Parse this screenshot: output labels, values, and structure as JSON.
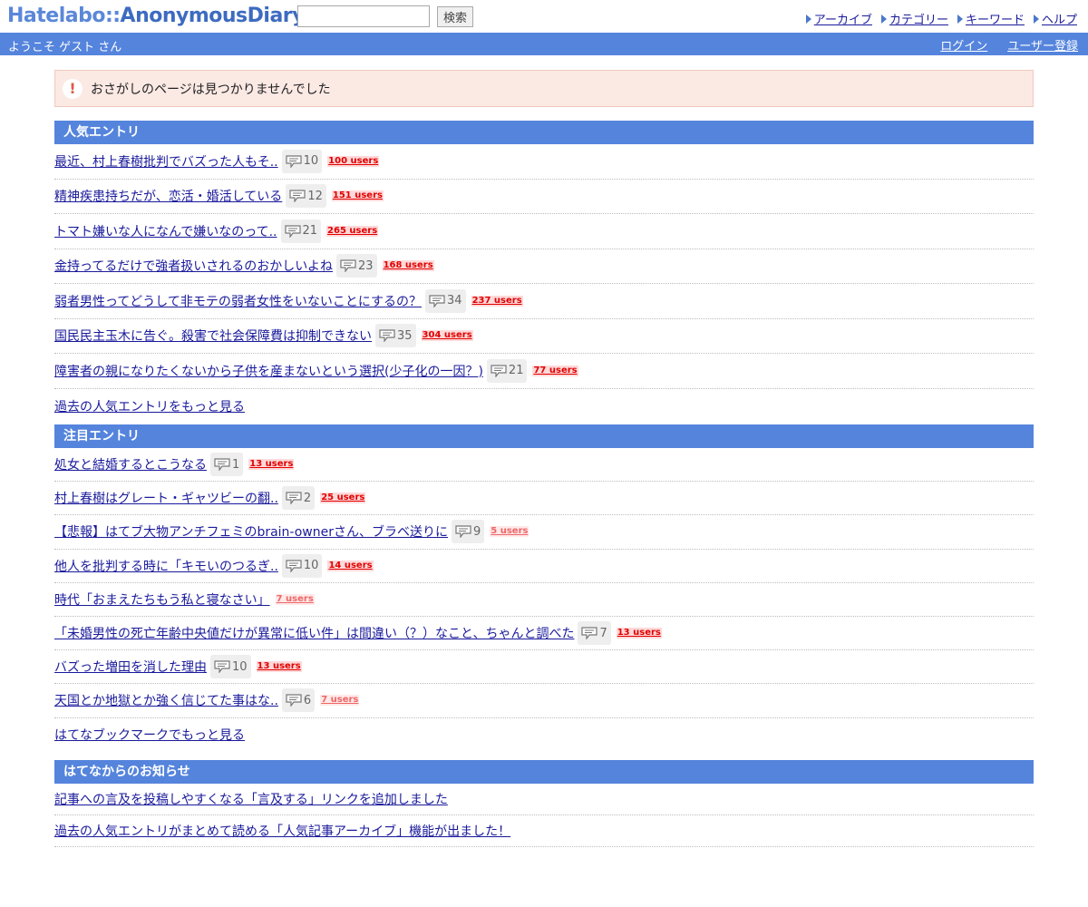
{
  "header": {
    "logo_main": "Hatelabo::",
    "logo_sub": "AnonymousDiary",
    "search_placeholder": "",
    "search_button": "検索",
    "nav": [
      "アーカイブ",
      "カテゴリー",
      "キーワード",
      "ヘルプ"
    ]
  },
  "bar": {
    "welcome": "ようこそ ゲスト さん",
    "login": "ログイン",
    "register": "ユーザー登録"
  },
  "notice": {
    "icon": "!",
    "text": "おさがしのページは見つかりませんでした"
  },
  "popular": {
    "title": "人気エントリ",
    "entries": [
      {
        "title": "最近、村上春樹批判でバズった人もそ..",
        "comments": "10",
        "users": "100 users",
        "style": "hot"
      },
      {
        "title": "精神疾患持ちだが、恋活・婚活している",
        "comments": "12",
        "users": "151 users",
        "style": "hot"
      },
      {
        "title": "トマト嫌いな人になんで嫌いなのって..",
        "comments": "21",
        "users": "265 users",
        "style": "hot"
      },
      {
        "title": "金持ってるだけで強者扱いされるのおかしいよね",
        "comments": "23",
        "users": "168 users",
        "style": "hot"
      },
      {
        "title": "弱者男性ってどうして非モテの弱者女性をいないことにするの？",
        "comments": "34",
        "users": "237 users",
        "style": "hot"
      },
      {
        "title": "国民民主玉木に告ぐ。殺害で社会保障費は抑制できない",
        "comments": "35",
        "users": "304 users",
        "style": "hot"
      },
      {
        "title": "障害者の親になりたくないから子供を産まないという選択(少子化の一因？)",
        "comments": "21",
        "users": "77 users",
        "style": "hot"
      }
    ],
    "more": "過去の人気エントリをもっと見る"
  },
  "featured": {
    "title": "注目エントリ",
    "entries": [
      {
        "title": "処女と結婚するとこうなる",
        "comments": "1",
        "users": "13 users",
        "style": "hot"
      },
      {
        "title": "村上春樹はグレート・ギャツビーの翻..",
        "comments": "2",
        "users": "25 users",
        "style": "hot"
      },
      {
        "title": "【悲報】はてブ大物アンチフェミのbrain-ownerさん、ブラベ送りに",
        "comments": "9",
        "users": "5 users",
        "style": "cool"
      },
      {
        "title": "他人を批判する時に「キモいのつるぎ..",
        "comments": "10",
        "users": "14 users",
        "style": "hot"
      },
      {
        "title": "時代「おまえたちもう私と寝なさい」",
        "comments": "",
        "users": "7 users",
        "style": "cool"
      },
      {
        "title": "「未婚男性の死亡年齢中央値だけが異常に低い件」は間違い（？）なこと、ちゃんと調べた",
        "comments": "7",
        "users": "13 users",
        "style": "hot"
      },
      {
        "title": "バズった増田を消した理由",
        "comments": "10",
        "users": "13 users",
        "style": "hot"
      },
      {
        "title": "天国とか地獄とか強く信じてた事はな..",
        "comments": "6",
        "users": "7 users",
        "style": "cool"
      }
    ],
    "more": "はてなブックマークでもっと見る"
  },
  "news": {
    "title": "はてなからのお知らせ",
    "entries": [
      "記事への言及を投稿しやすくなる「言及する」リンクを追加しました",
      "過去の人気エントリがまとめて読める「人気記事アーカイブ」機能が出ました！"
    ]
  }
}
